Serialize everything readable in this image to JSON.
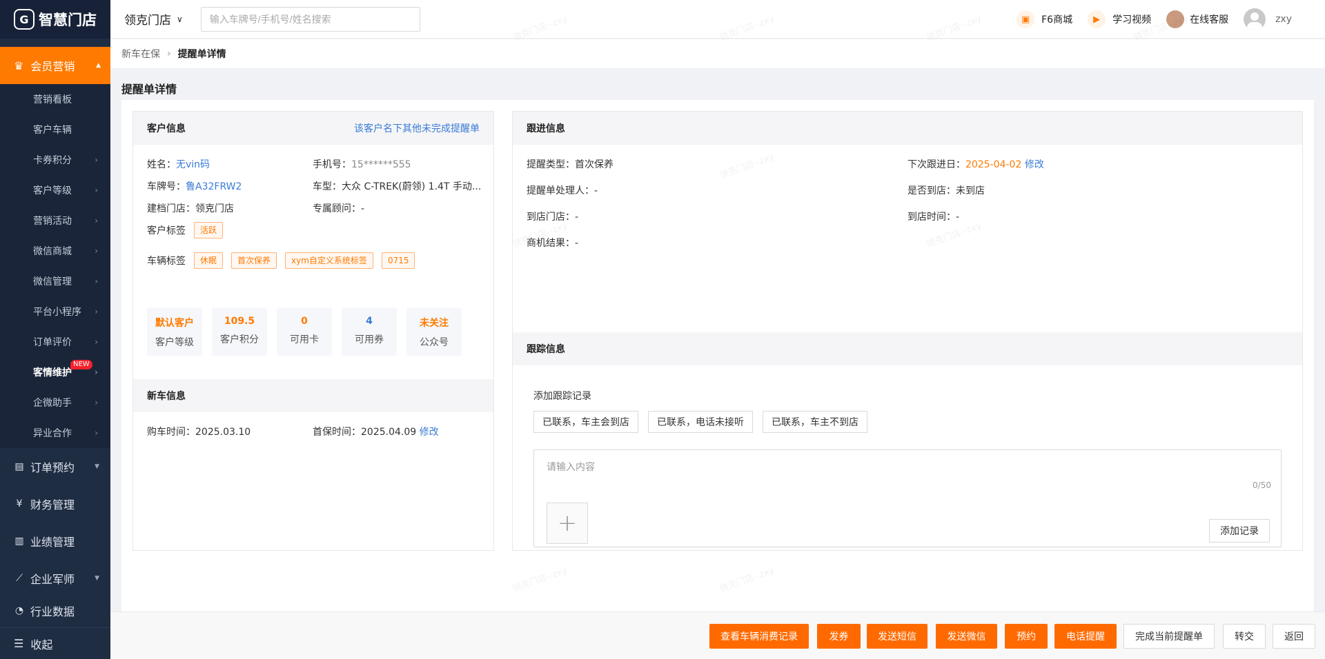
{
  "app": {
    "logo_text": "智慧门店",
    "logo_mark": "G"
  },
  "sidebar": {
    "active_group": {
      "label": "会员营销",
      "icon": "crown-icon"
    },
    "items": [
      {
        "label": "营销看板",
        "has_arrow": false
      },
      {
        "label": "客户车辆",
        "has_arrow": false
      },
      {
        "label": "卡券积分",
        "has_arrow": true
      },
      {
        "label": "客户等级",
        "has_arrow": true
      },
      {
        "label": "营销活动",
        "has_arrow": true
      },
      {
        "label": "微信商城",
        "has_arrow": true
      },
      {
        "label": "微信管理",
        "has_arrow": true
      },
      {
        "label": "平台小程序",
        "has_arrow": true
      },
      {
        "label": "订单评价",
        "has_arrow": true
      },
      {
        "label": "客情维护",
        "has_arrow": true,
        "badge": "NEW",
        "bold": true
      },
      {
        "label": "企微助手",
        "has_arrow": true
      },
      {
        "label": "异业合作",
        "has_arrow": true
      }
    ],
    "groups": [
      {
        "label": "订单预约",
        "icon": "clipboard-icon",
        "arrow": true
      },
      {
        "label": "财务管理",
        "icon": "yen-icon",
        "arrow": false
      },
      {
        "label": "业绩管理",
        "icon": "bar-chart-icon",
        "arrow": false
      },
      {
        "label": "企业军师",
        "icon": "line-chart-icon",
        "arrow": true
      },
      {
        "label": "行业数据",
        "icon": "data-icon",
        "arrow": false
      }
    ],
    "collapse_label": "收起"
  },
  "header": {
    "store_name": "领克门店",
    "search_placeholder": "输入车牌号/手机号/姓名搜索",
    "links": [
      {
        "label": "F6商城",
        "icon": "store-icon"
      },
      {
        "label": "学习视频",
        "icon": "play-icon"
      },
      {
        "label": "在线客服",
        "icon": "support-avatar-icon"
      }
    ],
    "user_name": "zxy"
  },
  "breadcrumb": {
    "parent": "新车在保",
    "current": "提醒单详情"
  },
  "page_title": "提醒单详情",
  "customer": {
    "title": "客户信息",
    "other_link": "该客户名下其他未完成提醒单",
    "name_label": "姓名：",
    "name_value": "无vin码",
    "phone_label": "手机号：",
    "phone_value": "15******555",
    "plate_label": "车牌号：",
    "plate_value": "鲁A32FRW2",
    "model_label": "车型：",
    "model_value": "大众 C-TREK(蔚领) 1.4T 手动...",
    "store_label": "建档门店：",
    "store_value": "领克门店",
    "advisor_label": "专属顾问：",
    "advisor_value": "-",
    "customer_tags_label": "客户标签",
    "customer_tags": [
      "活跃"
    ],
    "vehicle_tags_label": "车辆标签",
    "vehicle_tags": [
      "休眠",
      "首次保养",
      "xym自定义系统标签",
      "0715"
    ],
    "stats": [
      {
        "value": "默认客户",
        "label": "客户等级",
        "color": "orange"
      },
      {
        "value": "109.5",
        "label": "客户积分",
        "color": "orange"
      },
      {
        "value": "0",
        "label": "可用卡",
        "color": "orange"
      },
      {
        "value": "4",
        "label": "可用券",
        "color": "blue"
      },
      {
        "value": "未关注",
        "label": "公众号",
        "color": "orange"
      }
    ]
  },
  "new_car": {
    "title": "新车信息",
    "purchase_label": "购车时间：",
    "purchase_value": "2025.03.10",
    "first_label": "首保时间：",
    "first_value": "2025.04.09",
    "edit_label": "修改"
  },
  "followup": {
    "title": "跟进信息",
    "type_label": "提醒类型：",
    "type_value": "首次保养",
    "next_label": "下次跟进日：",
    "next_value": "2025-04-02",
    "edit_label": "修改",
    "handler_label": "提醒单处理人：",
    "handler_value": "-",
    "arrived_label": "是否到店：",
    "arrived_value": "未到店",
    "arrive_store_label": "到店门店：",
    "arrive_store_value": "-",
    "arrive_time_label": "到店时间：",
    "arrive_time_value": "-",
    "result_label": "商机结果：",
    "result_value": "-"
  },
  "tracking": {
    "title": "跟踪信息",
    "add_label": "添加跟踪记录",
    "quick_buttons": [
      "已联系，车主会到店",
      "已联系，电话未接听",
      "已联系，车主不到店"
    ],
    "input_placeholder": "请输入内容",
    "input_value": "",
    "counter": "0/50",
    "upload_symbol": "+",
    "add_button": "添加记录"
  },
  "bottom_actions": {
    "primary": [
      "查看车辆消费记录",
      "发券",
      "发送短信",
      "发送微信",
      "预约",
      "电话提醒"
    ],
    "plain": [
      "完成当前提醒单",
      "转交",
      "返回"
    ]
  },
  "watermark": "领克门店--zxy",
  "colors": {
    "accent": "#ff6a00",
    "sidebar": "#1f2d43",
    "link": "#3a7bd5"
  }
}
